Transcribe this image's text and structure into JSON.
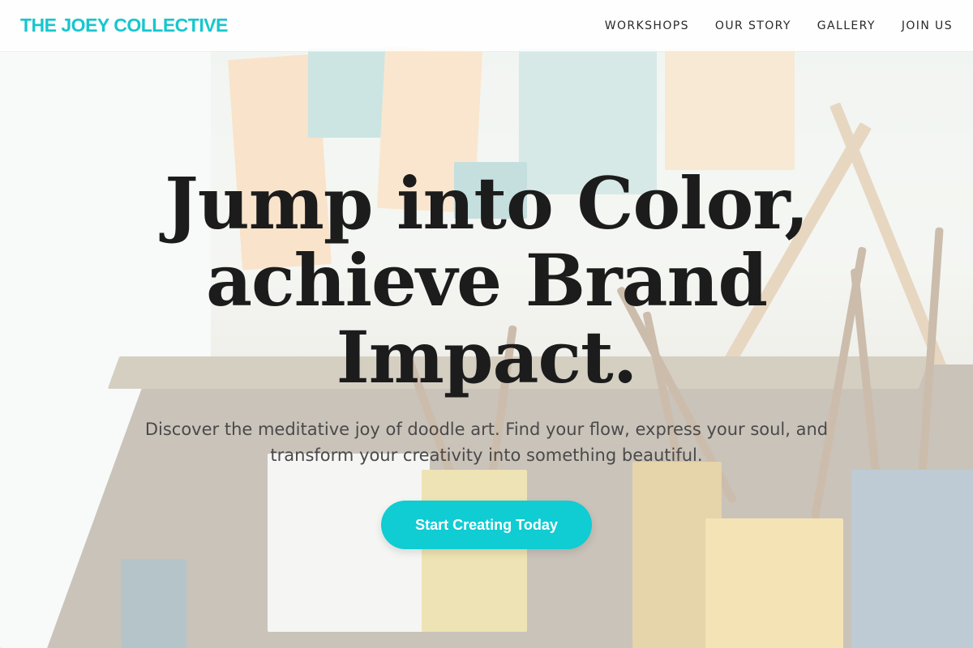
{
  "header": {
    "logo": "THE JOEY COLLECTIVE",
    "nav": [
      {
        "label": "WORKSHOPS"
      },
      {
        "label": "OUR STORY"
      },
      {
        "label": "GALLERY"
      },
      {
        "label": "JOIN US"
      }
    ]
  },
  "hero": {
    "headline_line1": "Jump into Color,",
    "headline_line2": "achieve Brand",
    "headline_line3": "Impact.",
    "subtext": "Discover the meditative joy of doodle art. Find your flow, express your soul, and transform your creativity into something beautiful.",
    "cta_label": "Start Creating Today"
  },
  "colors": {
    "accent": "#10ccd3",
    "logo": "#17c6cf",
    "headline": "#1c1c1c"
  }
}
